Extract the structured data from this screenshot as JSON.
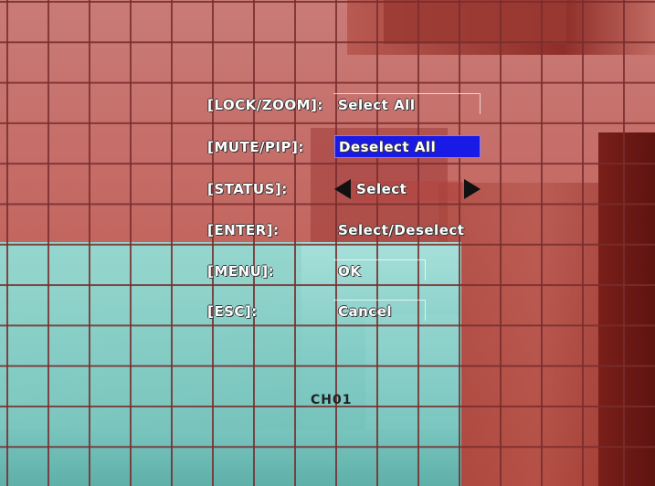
{
  "menu": {
    "rows": [
      {
        "key": "[LOCK/ZOOM]:",
        "value": "Select All"
      },
      {
        "key": "[MUTE/PIP]:",
        "value": "Deselect All"
      },
      {
        "key": "[STATUS]:",
        "value": "Select"
      },
      {
        "key": "[ENTER]:",
        "value": "Select/Deselect"
      },
      {
        "key": "[MENU]:",
        "value": "OK"
      },
      {
        "key": "[ESC]:",
        "value": "Cancel"
      }
    ]
  },
  "channel_label": "CH01",
  "colors": {
    "highlight": "#1a1ae6",
    "grid": "#782d2d",
    "red_zone": "#c46862",
    "cyan_zone": "#86cec7"
  }
}
